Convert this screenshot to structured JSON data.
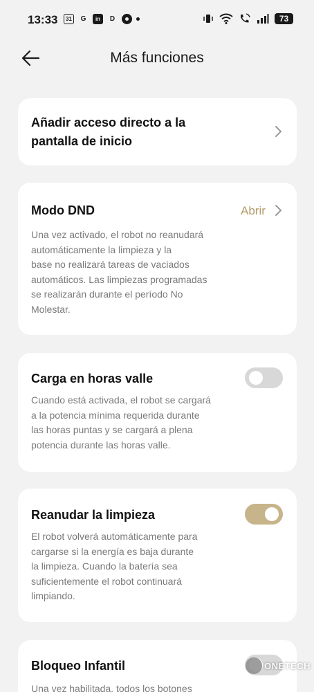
{
  "status_bar": {
    "time": "13:33",
    "app_icons": [
      "31",
      "G",
      "in",
      "D",
      "circle-app"
    ],
    "battery": "73"
  },
  "header": {
    "title": "Más funciones"
  },
  "cards": {
    "shortcut": {
      "title_line1": "Añadir acceso directo a la",
      "title_line2": "pantalla de inicio"
    },
    "dnd": {
      "title": "Modo DND",
      "action_label": "Abrir",
      "desc_lines": [
        "Una vez activado, el robot no reanudará",
        "automáticamente la limpieza y la",
        "base no realizará  tareas de vaciados",
        "automáticos. Las limpiezas programadas",
        "se realizarán durante el período No",
        "Molestar."
      ]
    },
    "offpeak": {
      "title": "Carga en horas valle",
      "enabled": false,
      "desc_lines": [
        "Cuando está activada, el robot se cargará",
        "a la potencia mínima requerida durante",
        "las horas puntas y se cargará a plena",
        "potencia durante las horas valle."
      ]
    },
    "resume": {
      "title": "Reanudar la limpieza",
      "enabled": true,
      "desc_lines": [
        "El robot volverá automáticamente para",
        "cargarse si la energía es baja durante",
        "la limpieza. Cuando la batería sea",
        "suficientemente el robot continuará",
        "limpiando."
      ]
    },
    "childlock": {
      "title": "Bloqueo Infantil",
      "enabled": false,
      "desc_lines": [
        "Una vez habilitada, todos los botones"
      ]
    }
  },
  "watermark": {
    "text": "ONETECH"
  },
  "colors": {
    "background": "#f2f2f2",
    "card": "#ffffff",
    "accent": "#b39a67",
    "toggle_on": "#c8b48b",
    "toggle_off": "#d8d8d8",
    "secondary_text": "#7a7a7a"
  }
}
